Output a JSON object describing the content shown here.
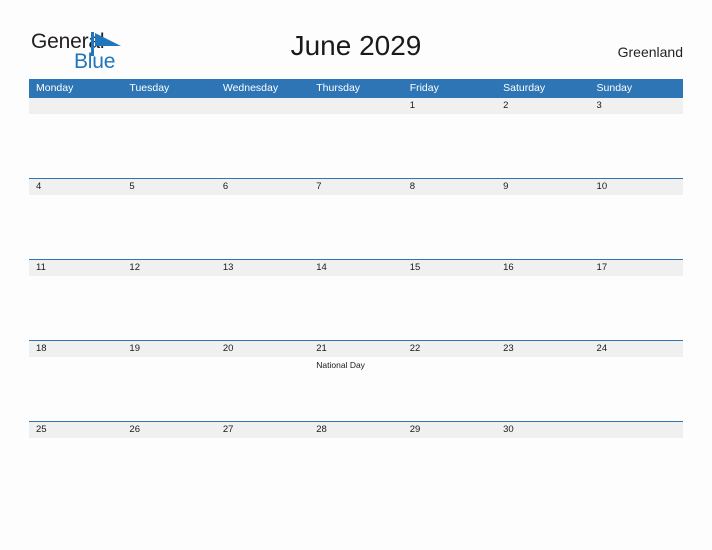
{
  "brand": {
    "name_part1": "General",
    "name_part2": "Blue",
    "mark": "triangle-flag-icon",
    "color_dark": "#231f20",
    "color_blue": "#1f76bc"
  },
  "header": {
    "title": "June 2029",
    "country": "Greenland"
  },
  "theme": {
    "header_blue": "#2e75b6",
    "date_band_gray": "#f0f0f0",
    "page_background": "#fdfdfd",
    "text_dark": "#1a1a1a"
  },
  "calendar": {
    "weekday_headers": [
      "Monday",
      "Tuesday",
      "Wednesday",
      "Thursday",
      "Friday",
      "Saturday",
      "Sunday"
    ],
    "weeks": [
      {
        "days": [
          {
            "date": "",
            "events": []
          },
          {
            "date": "",
            "events": []
          },
          {
            "date": "",
            "events": []
          },
          {
            "date": "",
            "events": []
          },
          {
            "date": "1",
            "events": []
          },
          {
            "date": "2",
            "events": []
          },
          {
            "date": "3",
            "events": []
          }
        ]
      },
      {
        "days": [
          {
            "date": "4",
            "events": []
          },
          {
            "date": "5",
            "events": []
          },
          {
            "date": "6",
            "events": []
          },
          {
            "date": "7",
            "events": []
          },
          {
            "date": "8",
            "events": []
          },
          {
            "date": "9",
            "events": []
          },
          {
            "date": "10",
            "events": []
          }
        ]
      },
      {
        "days": [
          {
            "date": "11",
            "events": []
          },
          {
            "date": "12",
            "events": []
          },
          {
            "date": "13",
            "events": []
          },
          {
            "date": "14",
            "events": []
          },
          {
            "date": "15",
            "events": []
          },
          {
            "date": "16",
            "events": []
          },
          {
            "date": "17",
            "events": []
          }
        ]
      },
      {
        "days": [
          {
            "date": "18",
            "events": []
          },
          {
            "date": "19",
            "events": []
          },
          {
            "date": "20",
            "events": []
          },
          {
            "date": "21",
            "events": [
              "National Day"
            ]
          },
          {
            "date": "22",
            "events": []
          },
          {
            "date": "23",
            "events": []
          },
          {
            "date": "24",
            "events": []
          }
        ]
      },
      {
        "days": [
          {
            "date": "25",
            "events": []
          },
          {
            "date": "26",
            "events": []
          },
          {
            "date": "27",
            "events": []
          },
          {
            "date": "28",
            "events": []
          },
          {
            "date": "29",
            "events": []
          },
          {
            "date": "30",
            "events": []
          },
          {
            "date": "",
            "events": []
          }
        ]
      }
    ]
  }
}
